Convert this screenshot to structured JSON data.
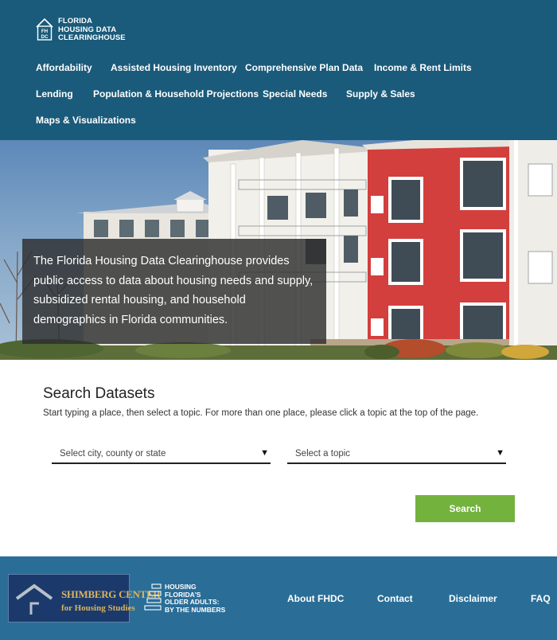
{
  "logo": {
    "abbr": "FHDC",
    "line1": "FLORIDA",
    "line2": "HOUSING DATA",
    "line3": "CLEARINGHOUSE"
  },
  "nav": {
    "items": [
      {
        "label": "Affordability"
      },
      {
        "label": "Assisted Housing Inventory"
      },
      {
        "label": "Comprehensive Plan Data"
      },
      {
        "label": "Income & Rent Limits"
      },
      {
        "label": "Lending"
      },
      {
        "label": "Population & Household Projections"
      },
      {
        "label": "Special Needs"
      },
      {
        "label": "Supply & Sales"
      },
      {
        "label": "Maps & Visualizations"
      }
    ]
  },
  "hero": {
    "caption": "The Florida Housing Data Clearinghouse provides public access to data about housing needs and supply, subsidized rental housing, and household demographics in Florida communities."
  },
  "search": {
    "title": "Search Datasets",
    "subtitle": "Start typing a place, then select a topic. For more than one place, please click a topic at the top of the page.",
    "place_placeholder": "Select city, county or state",
    "topic_placeholder": "Select a topic",
    "button_label": "Search"
  },
  "footer": {
    "shimberg_title": "SHIMBERG CENTER",
    "shimberg_sub": "for Housing Studies",
    "older_line1": "HOUSING",
    "older_line2": "FLORIDA'S",
    "older_line3": "OLDER ADULTS:",
    "older_line4": "BY THE NUMBERS",
    "links": [
      {
        "label": "About FHDC"
      },
      {
        "label": "Contact"
      },
      {
        "label": "Disclaimer"
      },
      {
        "label": "FAQ"
      }
    ]
  },
  "colors": {
    "header_bg": "#1a5a7a",
    "footer_bg": "#2a6e98",
    "search_button": "#74b23e",
    "shimberg_bg": "#1b3a6b",
    "shimberg_gold": "#d8b363"
  }
}
